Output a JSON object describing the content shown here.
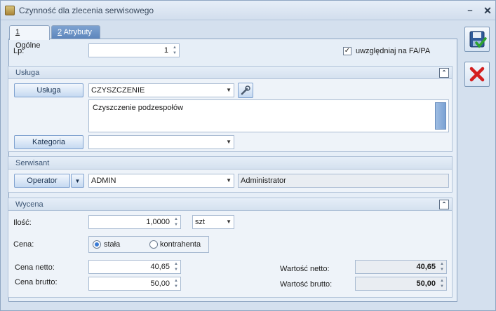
{
  "window": {
    "title": "Czynność dla zlecenia serwisowego",
    "minimize": "–",
    "close": "✕"
  },
  "tabs": [
    {
      "prefix": "1",
      "label": " Ogólne"
    },
    {
      "prefix": "2",
      "label": " Atrybuty"
    }
  ],
  "lp": {
    "label": "Lp:",
    "value": "1"
  },
  "uwzgledniaj": {
    "label": "uwzględniaj na FA/PA",
    "checked": "✓"
  },
  "usluga_group": {
    "title": "Usługa",
    "usluga_button": "Usługa",
    "usluga_value": "CZYSZCZENIE",
    "description": "Czyszczenie podzespołów",
    "kategoria_button": "Kategoria",
    "kategoria_value": ""
  },
  "serwisant_group": {
    "title": "Serwisant",
    "operator_button": "Operator",
    "operator_value": "ADMIN",
    "operator_name": "Administrator"
  },
  "wycena_group": {
    "title": "Wycena",
    "ilosc_label": "Ilość:",
    "ilosc_value": "1,0000",
    "unit_value": "szt",
    "cena_label": "Cena:",
    "radio_stala": "stała",
    "radio_kontrahenta": "kontrahenta",
    "cena_netto_label": "Cena netto:",
    "cena_netto_value": "40,65",
    "cena_brutto_label": "Cena brutto:",
    "cena_brutto_value": "50,00",
    "wartosc_netto_label": "Wartość netto:",
    "wartosc_netto_value": "40,65",
    "wartosc_brutto_label": "Wartość brutto:",
    "wartosc_brutto_value": "50,00"
  },
  "icons": {
    "save": "save-icon",
    "cancel": "cancel-icon",
    "collapse": "collapse-up-icon"
  },
  "colors": {
    "accent": "#5b84bb",
    "cancel": "#d42020"
  }
}
